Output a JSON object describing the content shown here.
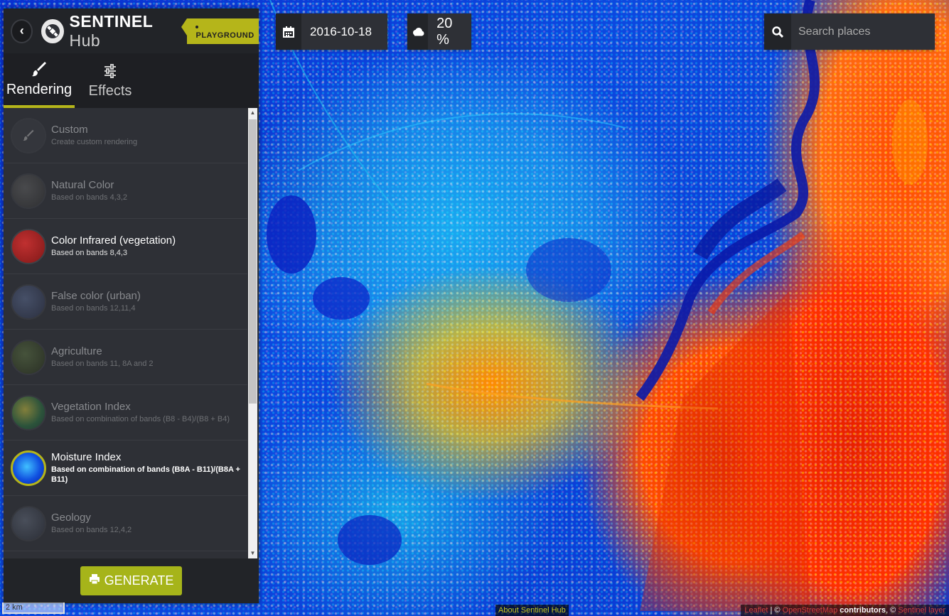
{
  "header": {
    "back_icon": "chevron-left-icon",
    "logo_icon": "satellite-icon",
    "brand_bold": "SENTINEL",
    "brand_light": "Hub",
    "badge": "PLAYGROUND",
    "accent_color": "#b5b51a"
  },
  "tabs": [
    {
      "label": "Rendering",
      "icon": "brush-icon",
      "active": true
    },
    {
      "label": "Effects",
      "icon": "sliders-icon",
      "active": false
    }
  ],
  "renderings": [
    {
      "title": "Custom",
      "subtitle": "Create custom rendering",
      "state": "dim"
    },
    {
      "title": "Natural Color",
      "subtitle": "Based on bands 4,3,2",
      "state": "dim"
    },
    {
      "title": "Color Infrared (vegetation)",
      "subtitle": "Based on bands 8,4,3",
      "state": "on"
    },
    {
      "title": "False color (urban)",
      "subtitle": "Based on bands 12,11,4",
      "state": "dim"
    },
    {
      "title": "Agriculture",
      "subtitle": "Based on bands 11, 8A and 2",
      "state": "dim"
    },
    {
      "title": "Vegetation Index",
      "subtitle": "Based on combination of bands (B8 - B4)/(B8 + B4)",
      "state": "dim"
    },
    {
      "title": "Moisture Index",
      "subtitle": "Based on combination of bands (B8A - B11)/(B8A + B11)",
      "state": "selected"
    },
    {
      "title": "Geology",
      "subtitle": "Based on bands 12,4,2",
      "state": "dim"
    }
  ],
  "footer": {
    "generate_label": "GENERATE",
    "icon": "print-icon"
  },
  "date_picker": {
    "icon": "calendar-icon",
    "value": "2016-10-18"
  },
  "cloud_filter": {
    "icon": "cloud-icon",
    "value": "20 %"
  },
  "search": {
    "icon": "search-icon",
    "placeholder": "Search places"
  },
  "map": {
    "scale": "2 km",
    "about_link": "About Sentinel Hub",
    "attribution": {
      "leaflet": "Leaflet",
      "separator": " | © ",
      "osm": "OpenStreetMap",
      "contributors": " contributors",
      "sep2": ", © ",
      "layer": "Sentinel layer"
    }
  }
}
